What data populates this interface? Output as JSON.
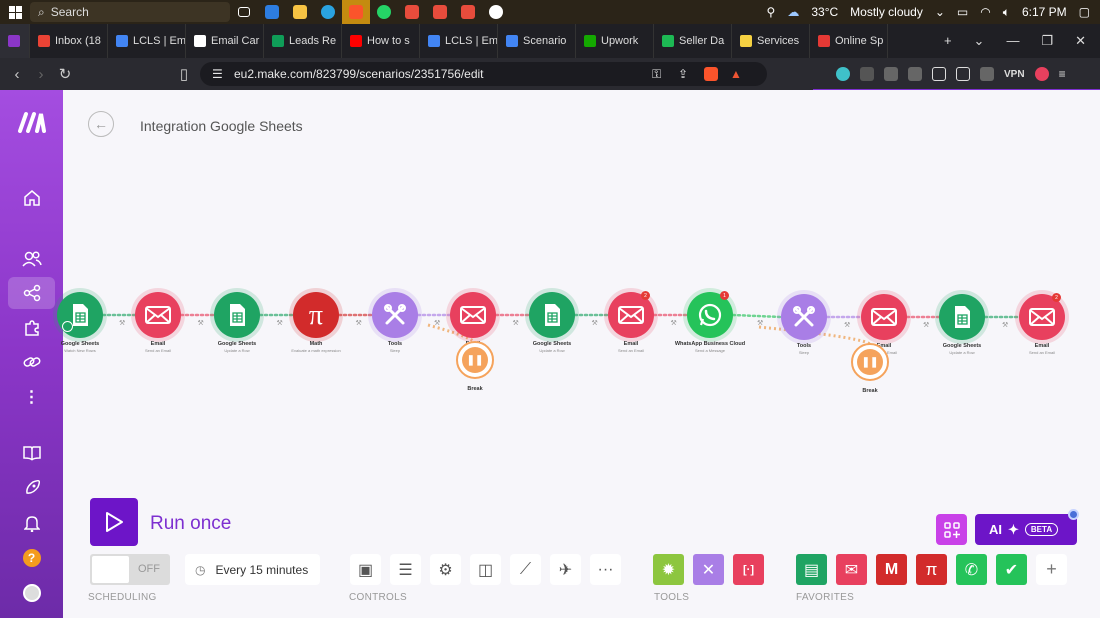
{
  "taskbar": {
    "search_placeholder": "Search",
    "weather": "33°C",
    "weather_desc": "Mostly cloudy",
    "time": "6:17 PM"
  },
  "tabs": [
    {
      "label": "",
      "color": "#8b36c8",
      "active": true
    },
    {
      "label": "Inbox (18",
      "color": "#ea4335"
    },
    {
      "label": "LCLS | Em",
      "color": "#4285f4"
    },
    {
      "label": "Email Car",
      "color": "#ffffff"
    },
    {
      "label": "Leads Re",
      "color": "#0f9d58"
    },
    {
      "label": "How to s",
      "color": "#ff0000"
    },
    {
      "label": "LCLS | Em",
      "color": "#4285f4"
    },
    {
      "label": "Scenario",
      "color": "#4285f4"
    },
    {
      "label": "Upwork",
      "color": "#14a800"
    },
    {
      "label": "Seller Da",
      "color": "#1db954"
    },
    {
      "label": "Services",
      "color": "#f5d142"
    },
    {
      "label": "Online Sp",
      "color": "#e53935"
    }
  ],
  "address": {
    "url": "eu2.make.com/823799/scenarios/2351756/edit",
    "vpn": "VPN"
  },
  "scenario": {
    "title": "Integration Google Sheets"
  },
  "modules": [
    {
      "name": "Google Sheets",
      "sub": "Watch New Rows",
      "color": "#1fa463",
      "icon": "sheets-icon"
    },
    {
      "name": "Email",
      "sub": "Send an Email",
      "color": "#e8405e",
      "icon": "email-icon"
    },
    {
      "name": "Google Sheets",
      "sub": "Update a Row",
      "color": "#1fa463",
      "icon": "sheets-icon"
    },
    {
      "name": "Math",
      "sub": "Evaluate a math expression",
      "color": "#d22b2b",
      "icon": "math-icon"
    },
    {
      "name": "Tools",
      "sub": "Sleep",
      "color": "#a97ee6",
      "icon": "tools-icon"
    },
    {
      "name": "Email",
      "sub": "Send an Email",
      "color": "#e8405e",
      "icon": "email-icon"
    },
    {
      "name": "Google Sheets",
      "sub": "Update a Row",
      "color": "#1fa463",
      "icon": "sheets-icon"
    },
    {
      "name": "Email",
      "sub": "Send an Email",
      "color": "#e8405e",
      "icon": "email-icon",
      "badge": "2"
    },
    {
      "name": "WhatsApp Business Cloud",
      "sub": "Send a Message",
      "color": "#25c35a",
      "icon": "whatsapp-icon",
      "badge": "1"
    },
    {
      "name": "Tools",
      "sub": "Sleep",
      "color": "#a97ee6",
      "icon": "tools-icon"
    },
    {
      "name": "Email",
      "sub": "Send an Email",
      "color": "#e8405e",
      "icon": "email-icon"
    },
    {
      "name": "Google Sheets",
      "sub": "Update a Row",
      "color": "#1fa463",
      "icon": "sheets-icon"
    },
    {
      "name": "Email",
      "sub": "Send an Email",
      "color": "#e8405e",
      "icon": "email-icon",
      "badge": "2"
    }
  ],
  "break_modules": [
    {
      "label": "Break"
    },
    {
      "label": "Break"
    }
  ],
  "run": {
    "label": "Run once"
  },
  "scheduling": {
    "toggle": "OFF",
    "interval": "Every 15 minutes",
    "section_label": "SCHEDULING"
  },
  "controls": {
    "section_label": "CONTROLS"
  },
  "tools": {
    "section_label": "TOOLS"
  },
  "favorites": {
    "section_label": "FAVORITES"
  },
  "ai": {
    "label": "AI",
    "beta": "BETA"
  }
}
